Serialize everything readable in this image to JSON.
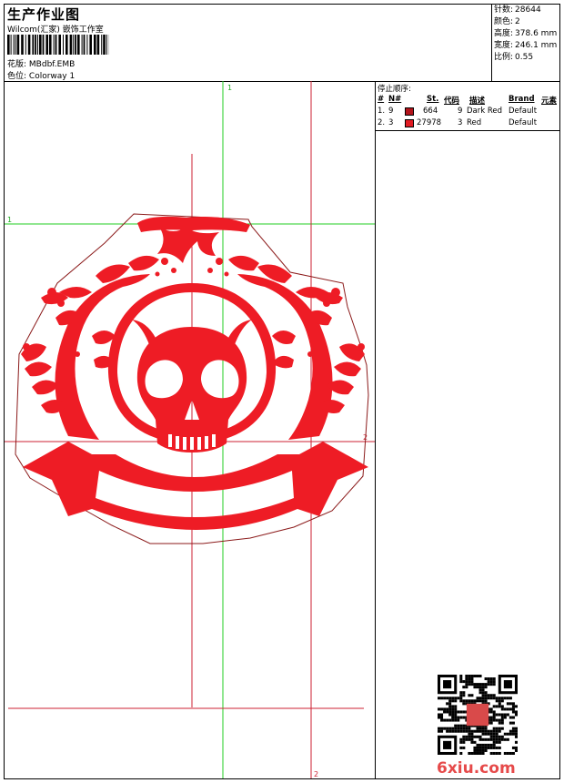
{
  "header": {
    "title": "生产作业图",
    "studio": "Wilcom(汇家) 嵌饰工作室",
    "design_label": "花版:",
    "design_value": "MBdbf.EMB",
    "colorway_label": "色位:",
    "colorway_value": "Colorway 1"
  },
  "stats": [
    {
      "label": "针数:",
      "value": "28644"
    },
    {
      "label": "颜色:",
      "value": "2"
    },
    {
      "label": "高度:",
      "value": "378.6 mm"
    },
    {
      "label": "宽度:",
      "value": "246.1 mm"
    },
    {
      "label": "比例:",
      "value": "0.55"
    }
  ],
  "stop_sequence": {
    "title": "停止顺序:",
    "columns": [
      "#",
      "N#",
      "St.",
      "代码",
      "描述",
      "Brand",
      "元素"
    ],
    "rows": [
      {
        "no": "1.",
        "needle": "9",
        "color": "#b3141b",
        "stitches": "664",
        "code": "9",
        "desc": "Dark Red",
        "brand": "Default"
      },
      {
        "no": "2.",
        "needle": "3",
        "color": "#e11b22",
        "stitches": "27978",
        "code": "3",
        "desc": "Red",
        "brand": "Default"
      }
    ]
  },
  "guides": {
    "marker_1": "1",
    "marker_2": "2"
  },
  "design_color": "#ee1c25",
  "outline_color": "#8b1a1a",
  "guide_green": "#22cc22",
  "guide_red": "#cc2233",
  "watermark": "6xiu.com"
}
